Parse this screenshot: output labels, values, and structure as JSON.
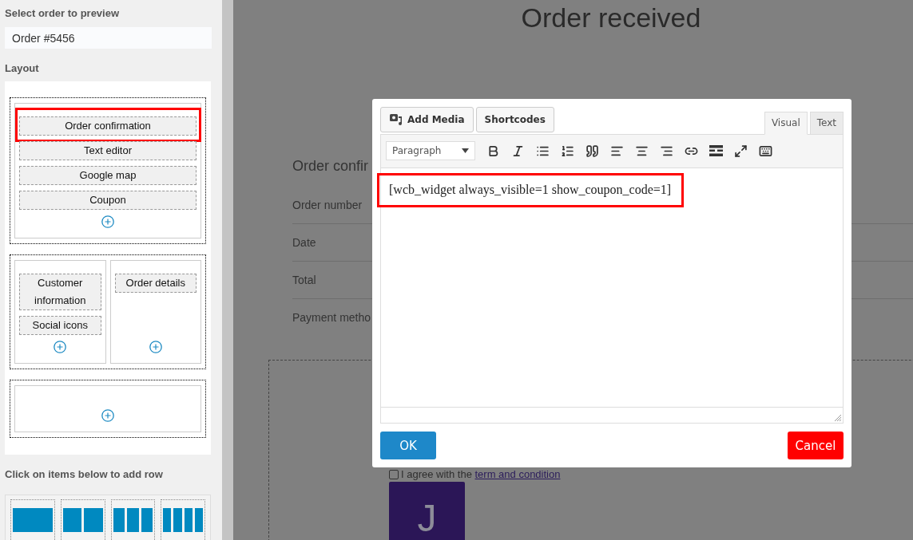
{
  "sidebar": {
    "select_label": "Select order to preview",
    "order_select": {
      "value": "Order #5456"
    },
    "layout_label": "Layout",
    "layout_rows": [
      {
        "columns": [
          {
            "kind": "filled",
            "items": [
              {
                "label": "Order confirmation",
                "highlighted": true
              },
              {
                "label": "Text editor",
                "highlighted": false
              },
              {
                "label": "Google map",
                "highlighted": false
              },
              {
                "label": "Coupon",
                "highlighted": false
              }
            ]
          }
        ]
      },
      {
        "columns": [
          {
            "kind": "filled",
            "items": [
              {
                "label": "Customer information",
                "highlighted": false
              },
              {
                "label": "Social icons",
                "highlighted": false
              }
            ]
          },
          {
            "kind": "filled",
            "items": [
              {
                "label": "Order details",
                "highlighted": false
              }
            ]
          }
        ]
      },
      {
        "columns": [
          {
            "kind": "empty"
          }
        ]
      }
    ],
    "add_row_label": "Click on items below to add row",
    "row_templates": [
      {
        "kind": "one"
      },
      {
        "kind": "two"
      },
      {
        "kind": "three"
      },
      {
        "kind": "four"
      }
    ]
  },
  "page": {
    "title": "Order received",
    "section_heading": "Order confir",
    "detail_rows": [
      {
        "label": "Order number"
      },
      {
        "label": "Date"
      },
      {
        "label": "Total"
      },
      {
        "label": "Payment metho"
      }
    ],
    "agreement": {
      "checked": false,
      "text": "I agree with the ",
      "link": "term and condition"
    },
    "avatar_letter": "J"
  },
  "dialog": {
    "media_buttons": [
      "Add Media",
      "Shortcodes"
    ],
    "tabs": [
      {
        "label": "Visual",
        "selected": true
      },
      {
        "label": "Text",
        "selected": false
      }
    ],
    "format_select": "Paragraph",
    "content": {
      "text": "[wcb_widget always_visible=1 show_coupon_code=1]",
      "highlighted": true
    },
    "ok_button": "OK",
    "cancel_button": "Cancel"
  }
}
